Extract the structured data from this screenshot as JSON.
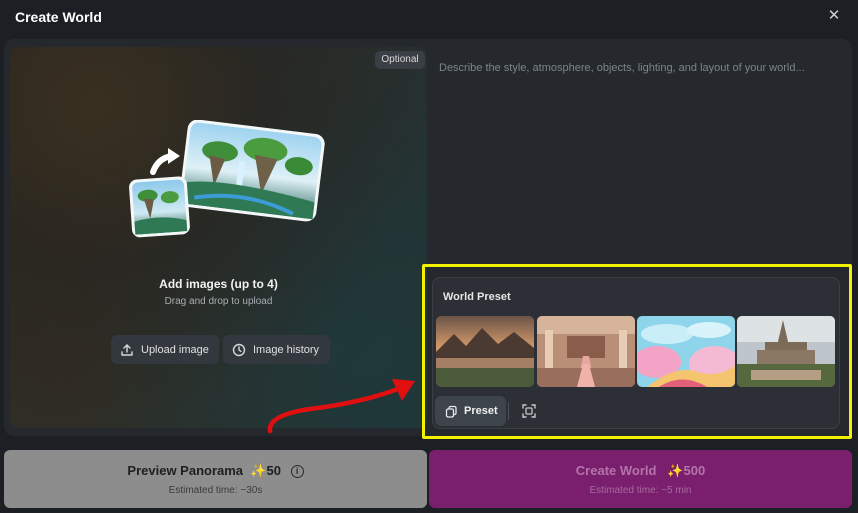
{
  "dialog": {
    "title": "Create World"
  },
  "upload": {
    "optional_badge": "Optional",
    "title": "Add images (up to 4)",
    "subtitle": "Drag and drop to upload",
    "upload_button": "Upload image",
    "history_button": "Image history"
  },
  "prompt": {
    "placeholder": "Describe the style, atmosphere, objects, lighting, and layout of your world..."
  },
  "preset": {
    "title": "World Preset",
    "button": "Preset",
    "thumbnails": [
      "mountain-lake-sunset",
      "ornate-palace-hall",
      "pastel-candy-land",
      "gothic-cathedral-village"
    ]
  },
  "actions": {
    "preview": {
      "label": "Preview Panorama",
      "cost": "50",
      "estimate": "Estimated time: ~30s"
    },
    "create": {
      "label": "Create World",
      "cost": "500",
      "estimate": "Estimated time: ~5 min"
    }
  },
  "colors": {
    "highlight": "#f3f000",
    "annotation_arrow": "#e01010",
    "create_button": "#7a1f6e",
    "preview_button": "#8d8d8d"
  }
}
